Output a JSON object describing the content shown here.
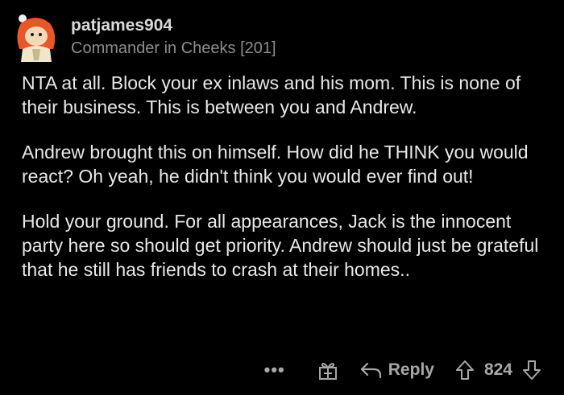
{
  "comment": {
    "author": "patjames904",
    "flair": "Commander in Cheeks [201]",
    "paragraphs": [
      "NTA at all.  Block your ex inlaws and his mom.  This is none of their business.  This is between you and Andrew.",
      "Andrew brought this on himself. How did he THINK you would react?  Oh yeah, he didn't think you would ever find out!",
      "Hold your ground. For all appearances, Jack is the innocent party here so should get priority. Andrew should just be grateful that he still has friends to crash at their homes.."
    ]
  },
  "actions": {
    "more_glyph": "•••",
    "reply_label": "Reply",
    "score": "824",
    "icons": {
      "more": "more-options-icon",
      "gift": "award-gift-icon",
      "reply": "reply-arrow-icon",
      "upvote": "upvote-arrow-icon",
      "downvote": "downvote-arrow-icon"
    }
  },
  "colors": {
    "background": "#000000",
    "text": "#e8e8e8",
    "muted": "#8d8d8d",
    "icon": "#a8a8a8",
    "avatar_accent": "#e8572a"
  }
}
